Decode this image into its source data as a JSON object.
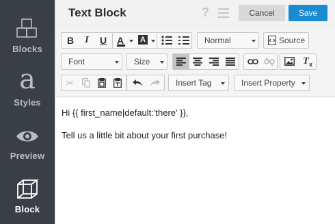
{
  "sidebar": {
    "items": [
      {
        "label": "Blocks"
      },
      {
        "label": "Styles"
      },
      {
        "label": "Preview"
      },
      {
        "label": "Block"
      }
    ]
  },
  "header": {
    "title": "Text Block",
    "help": "?",
    "cancel_label": "Cancel",
    "save_label": "Save",
    "save_color": "#1a8ad1"
  },
  "toolbar": {
    "format_select": "Normal",
    "source_label": "Source",
    "font_select": "Font",
    "size_select": "Size",
    "insert_tag_label": "Insert Tag",
    "insert_property_label": "Insert Property"
  },
  "editor": {
    "line1": "Hi {{ first_name|default:'there' }},",
    "line2": "Tell us a little bit about your first purchase!"
  }
}
